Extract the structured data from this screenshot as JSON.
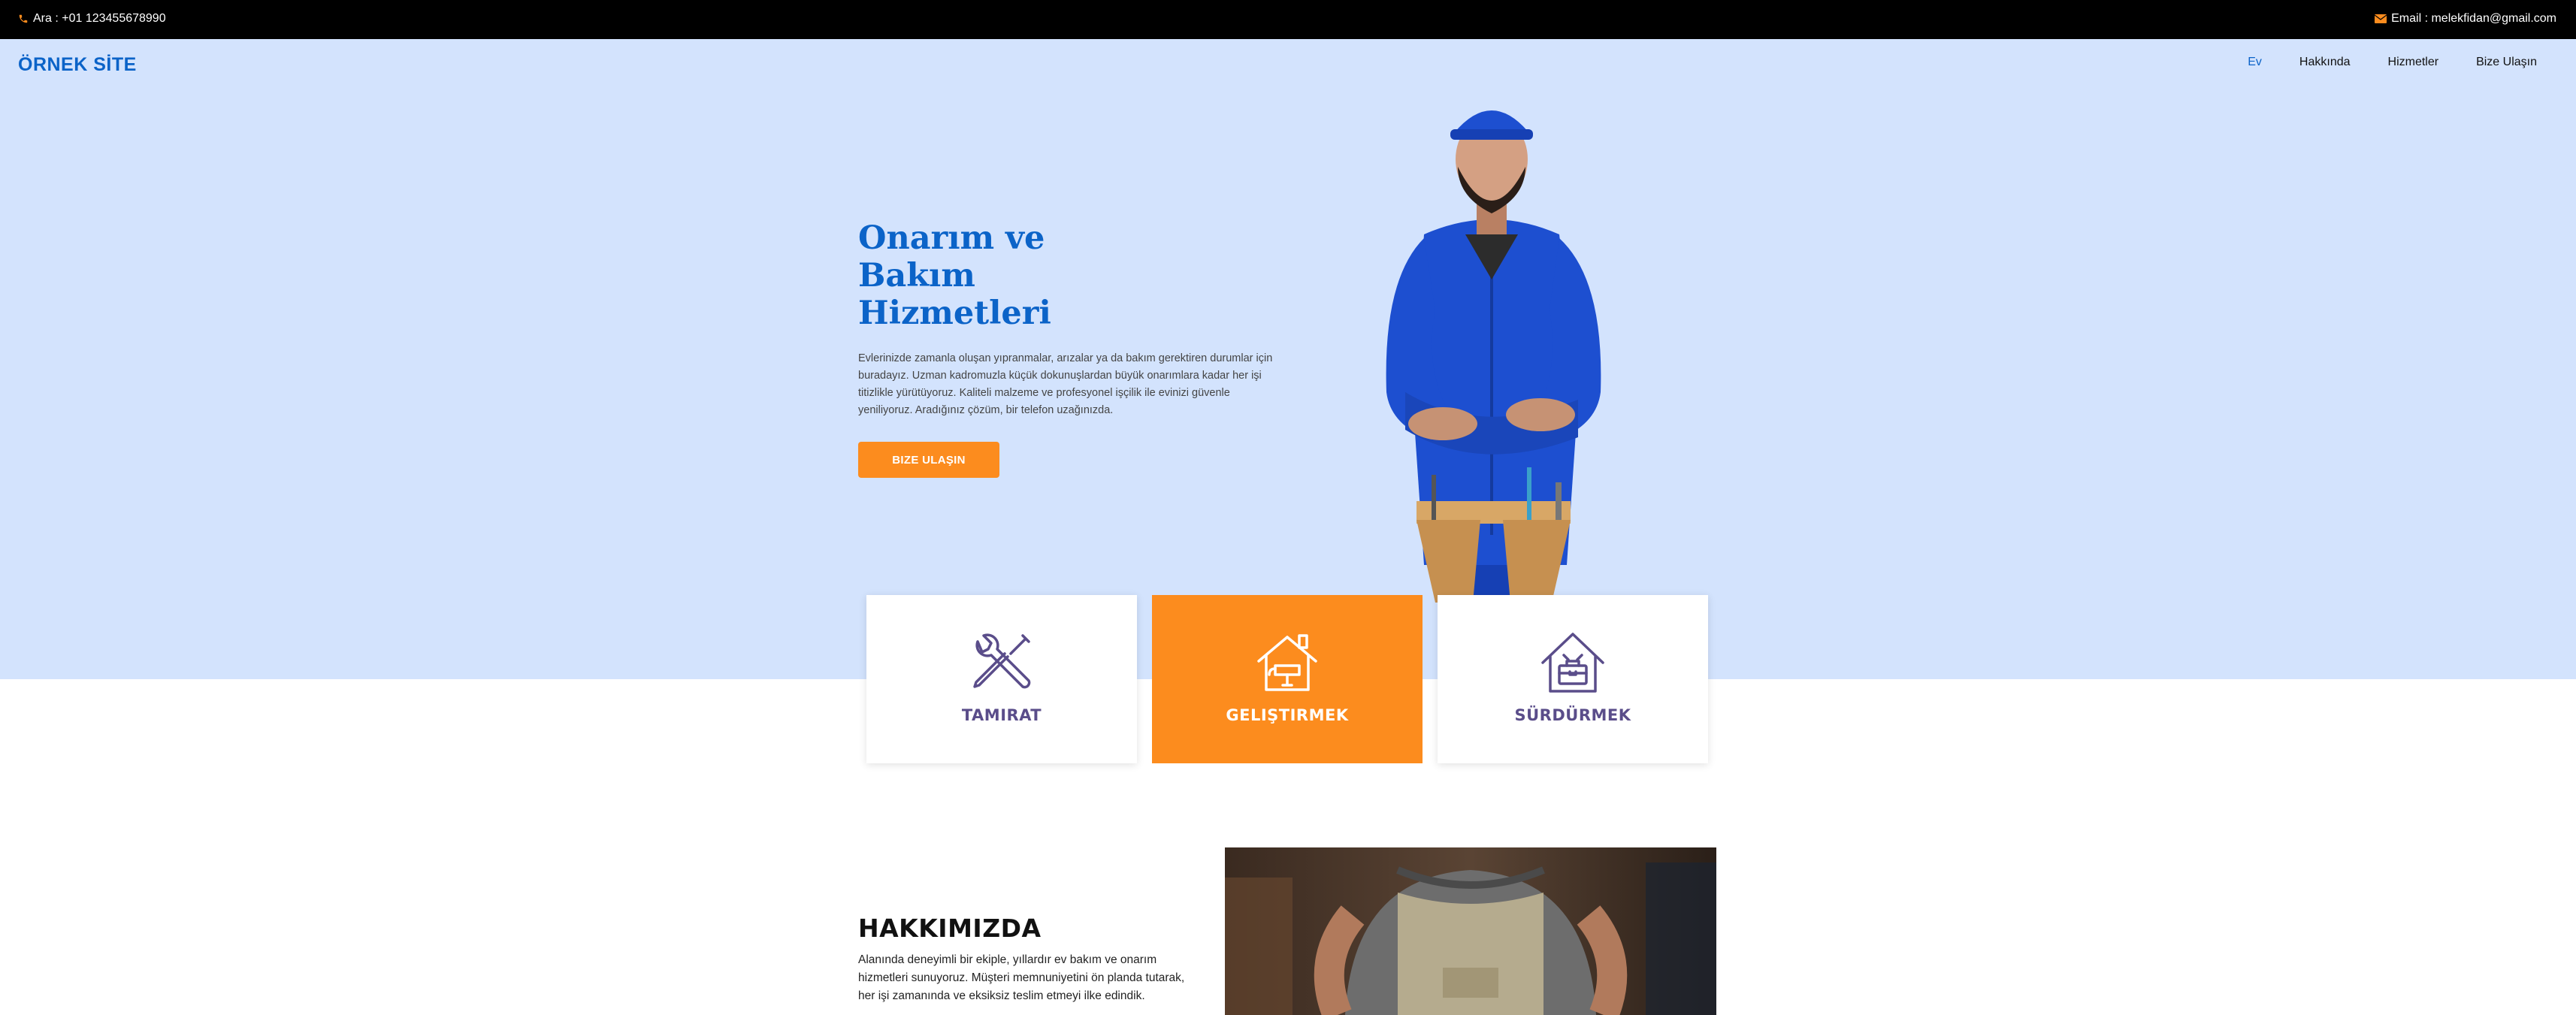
{
  "topbar": {
    "phone": "Ara : +01 123455678990",
    "email": "Email : melekfidan@gmail.com"
  },
  "brand": "ÖRNEK SİTE",
  "nav": {
    "items": [
      {
        "label": "Ev",
        "active": true
      },
      {
        "label": "Hakkında"
      },
      {
        "label": "Hizmetler"
      },
      {
        "label": "Bize Ulaşın"
      }
    ]
  },
  "hero": {
    "title_lines": [
      "Onarım ve",
      "Bakım",
      "Hizmetleri"
    ],
    "text": "Evlerinizde zamanla oluşan yıpranmalar, arızalar ya da bakım gerektiren durumlar için buradayız. Uzman kadromuzla küçük dokunuşlardan büyük onarımlara kadar her işi titizlikle yürütüyoruz. Kaliteli malzeme ve profesyonel işçilik ile evinizi güvenle yeniliyoruz. Aradığınız çözüm, bir telefon uzağınızda.",
    "button": "BIZE ULAŞIN"
  },
  "services": [
    {
      "label": "TAMIRAT",
      "icon": "wrench-screwdriver-icon"
    },
    {
      "label": "GELIŞTIRMEK",
      "icon": "house-paint-icon"
    },
    {
      "label": "SÜRDÜRMEK",
      "icon": "house-toolbox-icon"
    }
  ],
  "about": {
    "title": "HAKKIMIZDA",
    "text": "Alanında deneyimli bir ekiple, yıllardır ev bakım ve onarım hizmetleri sunuyoruz. Müşteri memnuniyetini ön planda tutarak, her işi zamanında ve eksiksiz teslim etmeyi ilke edindik."
  },
  "colors": {
    "accent": "#fc8c1e",
    "brand_blue": "#0b63c8",
    "hero_bg": "#d3e3fd",
    "icon_purple": "#5a4d8a"
  }
}
